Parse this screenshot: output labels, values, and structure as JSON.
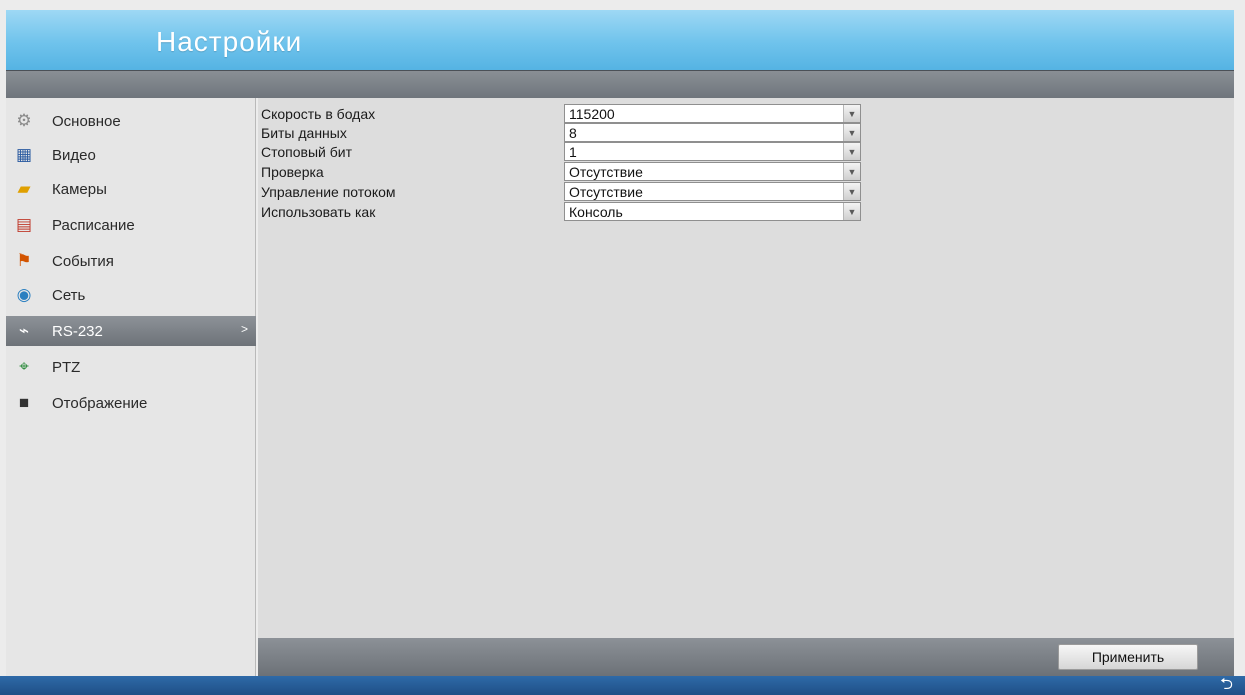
{
  "header": {
    "title": "Настройки"
  },
  "sidebar": {
    "items": [
      {
        "label": "Основное",
        "icon": "gear-icon",
        "glyph": "⚙",
        "color": "#8a8a8a"
      },
      {
        "label": "Видео",
        "icon": "monitor-icon",
        "glyph": "▦",
        "color": "#2a5aa0"
      },
      {
        "label": "Камеры",
        "icon": "folder-icon",
        "glyph": "▰",
        "color": "#e0a000"
      },
      {
        "label": "Расписание",
        "icon": "calendar-icon",
        "glyph": "▤",
        "color": "#c0392b"
      },
      {
        "label": "События",
        "icon": "event-icon",
        "glyph": "⚑",
        "color": "#d35400"
      },
      {
        "label": "Сеть",
        "icon": "globe-icon",
        "glyph": "◉",
        "color": "#2a7fc0"
      },
      {
        "label": "RS-232",
        "icon": "serial-icon",
        "glyph": "⌁",
        "color": "#ffffff",
        "active": true,
        "chevron": ">"
      },
      {
        "label": "PTZ",
        "icon": "ptz-icon",
        "glyph": "⌖",
        "color": "#2a8a3a"
      },
      {
        "label": "Отображение",
        "icon": "display-icon",
        "glyph": "■",
        "color": "#333333"
      }
    ]
  },
  "form": {
    "rows": [
      {
        "label": "Скорость в бодах",
        "value": "115200"
      },
      {
        "label": "Биты данных",
        "value": "8"
      },
      {
        "label": "Стоповый бит",
        "value": "1"
      },
      {
        "label": "Проверка",
        "value": "Отсутствие"
      },
      {
        "label": "Управление потоком",
        "value": "Отсутствие"
      },
      {
        "label": "Использовать как",
        "value": "Консоль"
      }
    ]
  },
  "footer": {
    "apply_label": "Применить"
  },
  "bottom": {
    "back_glyph": "⮌"
  },
  "colors": {
    "accent": "#6fc3ec",
    "active_nav": "#7a7f85",
    "bottom_strip": "#2e6aa8"
  }
}
